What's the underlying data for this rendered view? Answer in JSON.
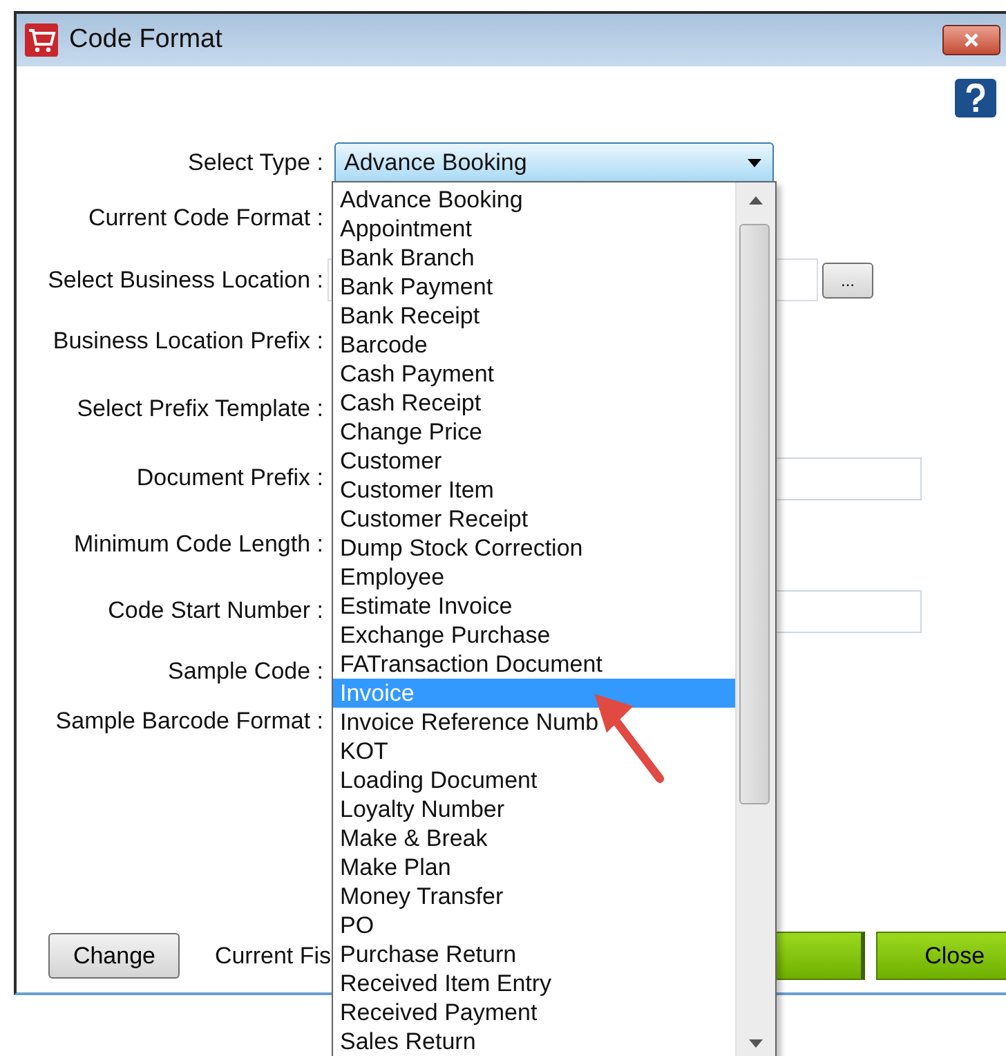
{
  "window": {
    "title": "Code Format"
  },
  "rows": [
    {
      "label": "Select Type :",
      "kind": "dropdown",
      "value": "Advance Booking"
    },
    {
      "label": "Current Code Format :",
      "kind": "text"
    },
    {
      "label": "Select Business Location :",
      "kind": "field-browse",
      "button": "..."
    },
    {
      "label": "Business Location Prefix :",
      "kind": "text"
    },
    {
      "label": "Select Prefix Template  :",
      "kind": "text"
    },
    {
      "label": "Document Prefix :",
      "kind": "field"
    },
    {
      "label": "Minimum Code Length :",
      "kind": "text"
    },
    {
      "label": "Code Start Number :",
      "kind": "field"
    },
    {
      "label": "Sample Code :",
      "kind": "text"
    },
    {
      "label": "Sample Barcode Format :",
      "kind": "text"
    }
  ],
  "dropdown_list": [
    {
      "label": "Advance Booking",
      "selected": false
    },
    {
      "label": "Appointment",
      "selected": false
    },
    {
      "label": "Bank Branch",
      "selected": false
    },
    {
      "label": "Bank Payment",
      "selected": false
    },
    {
      "label": "Bank Receipt",
      "selected": false
    },
    {
      "label": "Barcode",
      "selected": false
    },
    {
      "label": "Cash Payment",
      "selected": false
    },
    {
      "label": "Cash Receipt",
      "selected": false
    },
    {
      "label": "Change Price",
      "selected": false
    },
    {
      "label": "Customer",
      "selected": false
    },
    {
      "label": "Customer Item",
      "selected": false
    },
    {
      "label": "Customer Receipt",
      "selected": false
    },
    {
      "label": "Dump Stock Correction",
      "selected": false
    },
    {
      "label": "Employee",
      "selected": false
    },
    {
      "label": "Estimate Invoice",
      "selected": false
    },
    {
      "label": "Exchange Purchase",
      "selected": false
    },
    {
      "label": "FATransaction Document",
      "selected": false
    },
    {
      "label": "Invoice",
      "selected": true
    },
    {
      "label": "Invoice Reference Numb",
      "selected": false
    },
    {
      "label": "KOT",
      "selected": false
    },
    {
      "label": "Loading Document",
      "selected": false
    },
    {
      "label": "Loyalty Number",
      "selected": false
    },
    {
      "label": "Make & Break",
      "selected": false
    },
    {
      "label": "Make Plan",
      "selected": false
    },
    {
      "label": "Money Transfer",
      "selected": false
    },
    {
      "label": "PO",
      "selected": false
    },
    {
      "label": "Purchase Return",
      "selected": false
    },
    {
      "label": "Received Item Entry",
      "selected": false
    },
    {
      "label": "Received Payment",
      "selected": false
    },
    {
      "label": "Sales Return",
      "selected": false
    }
  ],
  "footer": {
    "change_button": "Change",
    "fiscal_label": "Current Fis",
    "close_button": "Close"
  }
}
